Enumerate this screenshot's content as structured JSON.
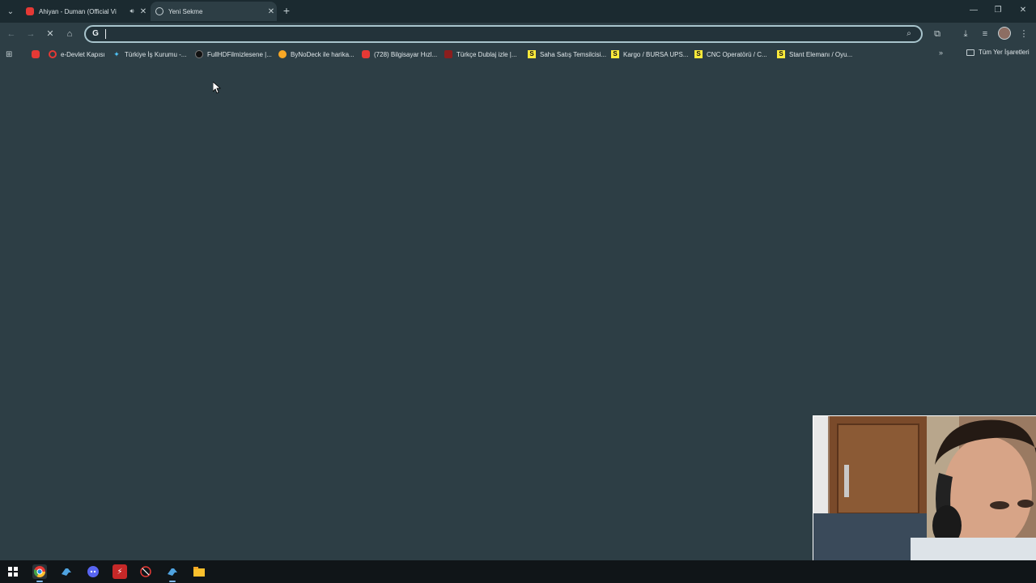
{
  "tabs": [
    {
      "title": "Ahiyan - Duman (Official Vi",
      "icon": "youtube-icon",
      "audio": true
    },
    {
      "title": "Yeni Sekme",
      "icon": "chrome-icon",
      "active": true
    }
  ],
  "omnibox": {
    "value": "",
    "placeholder": ""
  },
  "bookmarks": [
    {
      "label": "",
      "icon": "youtube-icon"
    },
    {
      "label": "e-Devlet Kapısı",
      "icon": "edevlet-icon"
    },
    {
      "label": "Türkiye İş Kurumu -...",
      "icon": "iskur-icon"
    },
    {
      "label": "FullHDFilmizlesene |...",
      "icon": "film-icon"
    },
    {
      "label": "ByNoDeck ile harika...",
      "icon": "bynodeck-icon"
    },
    {
      "label": "(728) Bilgisayar Hızl...",
      "icon": "youtube-icon"
    },
    {
      "label": "Türkçe Dublaj izle |...",
      "icon": "dublaj-icon"
    },
    {
      "label": "Saha Satış Temsilcisi...",
      "icon": "s-icon"
    },
    {
      "label": "Kargo / BURSA UPS...",
      "icon": "s-icon"
    },
    {
      "label": "CNC Operatörü / C...",
      "icon": "s-icon"
    },
    {
      "label": "Stant Elemanı / Oyu...",
      "icon": "s-icon"
    }
  ],
  "all_bookmarks_label": "Tüm Yer İşaretleri",
  "colors": {
    "background": "#2d3e45",
    "tabstrip": "#1b2a30",
    "taskbar": "#101518",
    "focus_ring": "#a8c4cc"
  },
  "taskbar_apps": [
    "windows-start-icon",
    "chrome-icon",
    "steam-icon",
    "discord-icon",
    "adobe-icon",
    "origin-icon",
    "steam-icon",
    "file-explorer-icon"
  ]
}
